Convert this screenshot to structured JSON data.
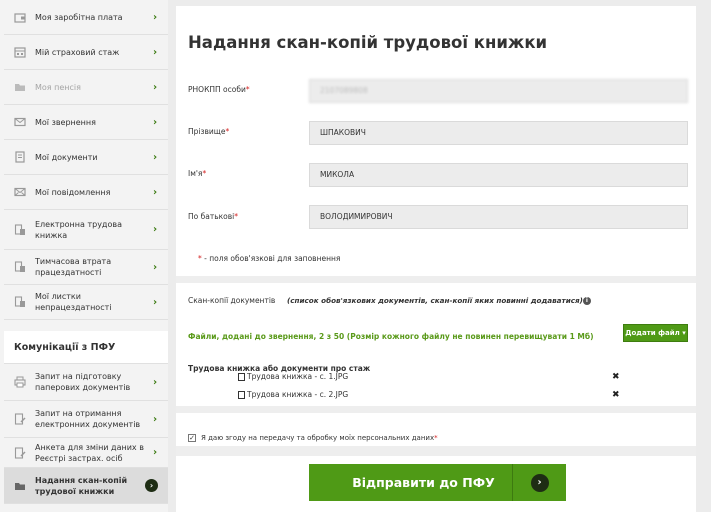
{
  "sidebar": {
    "items": [
      {
        "label": "Моя заробітна плата",
        "icon": "wallet-icon",
        "disabled": false
      },
      {
        "label": "Мій страховий стаж",
        "icon": "calendar-icon",
        "disabled": false
      },
      {
        "label": "Моя пенсія",
        "icon": "folder-icon",
        "disabled": true
      },
      {
        "label": "Мої звернення",
        "icon": "envelope-icon",
        "disabled": false
      },
      {
        "label": "Мої документи",
        "icon": "document-icon",
        "disabled": false
      },
      {
        "label": "Мої повідомлення",
        "icon": "mail-icon",
        "disabled": false
      },
      {
        "label": "Електронна трудова книжка",
        "icon": "workbook-icon",
        "disabled": false
      },
      {
        "label": "Тимчасова втрата працездатності",
        "icon": "sick-leave-icon",
        "disabled": false
      },
      {
        "label": "Мої листки непрацездатності",
        "icon": "sick-sheet-icon",
        "disabled": false
      }
    ],
    "section_title": "Комунікації з ПФУ",
    "comm_items": [
      {
        "label": "Запит на підготовку паперових документів",
        "icon": "printer-icon",
        "active": false
      },
      {
        "label": "Запит на отримання електронних документів",
        "icon": "edit-document-icon",
        "active": false
      },
      {
        "label": "Анкета для зміни даних в Реєстрі застрах. осіб",
        "icon": "form-edit-icon",
        "active": false
      },
      {
        "label": "Надання скан-копій трудової книжки",
        "icon": "scan-icon",
        "active": true
      }
    ]
  },
  "main": {
    "title": "Надання скан-копій трудової книжки",
    "fields": [
      {
        "label": "РНОКПП особи",
        "value": "2107089808"
      },
      {
        "label": "Прізвище",
        "value": "ШПАКОВИЧ"
      },
      {
        "label": "Ім'я",
        "value": "МИКОЛА"
      },
      {
        "label": "По батькові",
        "value": "ВОЛОДИМИРОВИЧ"
      }
    ],
    "required_note": "- поля обов'язкові для заповнення",
    "scan_label": "Скан-копії документів",
    "scan_hint": "(список обов'язкових документів, скан-копії яких повинні додаватися)",
    "files_note": "Файли, додані до звернення, 2 з 50 (Розмір кожного файлу не повинен перевищувати 1 Мб)",
    "add_file_button": "Додати файл ▾",
    "doc_group_title": "Трудова книжка або документи про стаж",
    "files": [
      {
        "name": "Трудова книжка - с. 1.JPG"
      },
      {
        "name": "Трудова книжка - с. 2.JPG"
      }
    ],
    "consent_label": "Я даю згоду на передачу та обробку моїх персональних даних",
    "consent_checked": true,
    "submit_label": "Відправити до ПФУ"
  },
  "colors": {
    "accent": "#4f9a16",
    "required": "#d42020",
    "dark_circle": "#1e2d14"
  }
}
